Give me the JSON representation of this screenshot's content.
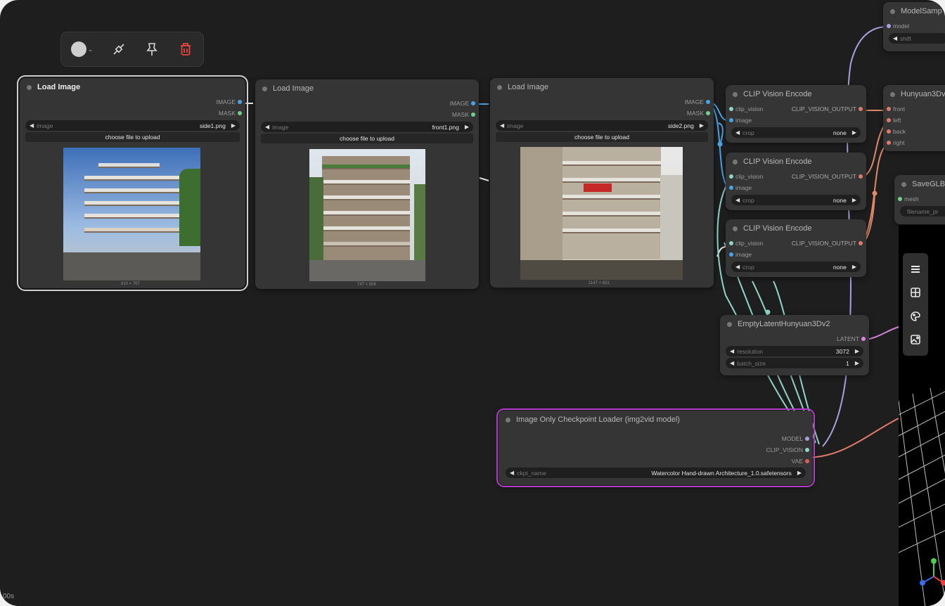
{
  "toolbar": {
    "color_swatch": "#cfcfcf",
    "icons": [
      "color-picker",
      "bypass-icon",
      "pin-icon",
      "delete-icon"
    ]
  },
  "nodes": {
    "load1": {
      "title": "Load Image",
      "outputs": [
        "IMAGE",
        "MASK"
      ],
      "image_label": "image",
      "image_value": "side1.png",
      "upload": "choose file to upload",
      "dims": "810 × 767"
    },
    "load2": {
      "title": "Load Image",
      "outputs": [
        "IMAGE",
        "MASK"
      ],
      "image_label": "image",
      "image_value": "front1.png",
      "upload": "choose file to upload",
      "dims": "747 × 808"
    },
    "load3": {
      "title": "Load Image",
      "outputs": [
        "IMAGE",
        "MASK"
      ],
      "image_label": "image",
      "image_value": "side2.png",
      "upload": "choose file to upload",
      "dims": "1147 × 831"
    },
    "clip1": {
      "title": "CLIP Vision Encode",
      "in1": "clip_vision",
      "in2": "image",
      "out": "CLIP_VISION_OUTPUT",
      "crop_label": "crop",
      "crop_value": "none"
    },
    "clip2": {
      "title": "CLIP Vision Encode",
      "in1": "clip_vision",
      "in2": "image",
      "out": "CLIP_VISION_OUTPUT",
      "crop_label": "crop",
      "crop_value": "none"
    },
    "clip3": {
      "title": "CLIP Vision Encode",
      "in1": "clip_vision",
      "in2": "image",
      "out": "CLIP_VISION_OUTPUT",
      "crop_label": "crop",
      "crop_value": "none"
    },
    "latent": {
      "title": "EmptyLatentHunyuan3Dv2",
      "out": "LATENT",
      "res_label": "resolution",
      "res_value": "3072",
      "batch_label": "batch_size",
      "batch_value": "1"
    },
    "ckpt": {
      "title": "Image Only Checkpoint Loader (img2vid model)",
      "outputs": [
        "MODEL",
        "CLIP_VISION",
        "VAE"
      ],
      "ckpt_label": "ckpt_name",
      "ckpt_value": "Watercolor Hand-drawn Architecture_1.0.safetensors"
    },
    "modelsampling": {
      "title": "ModelSamp",
      "in": "model",
      "shift_label": "shift"
    },
    "hunyuan": {
      "title": "Hunyuan3Dv2",
      "inputs": [
        "front",
        "left",
        "back",
        "right"
      ]
    },
    "saveglb": {
      "title": "SaveGLB",
      "in": "mesh",
      "filename_label": "filename_pr"
    }
  },
  "status": "00s"
}
